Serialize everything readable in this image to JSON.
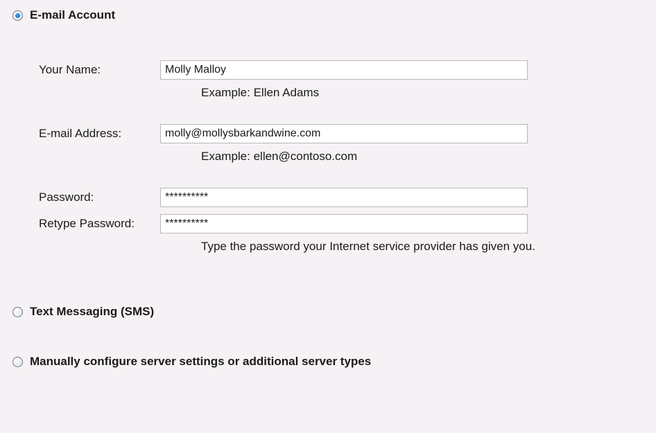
{
  "options": {
    "email": "E-mail Account",
    "sms": "Text Messaging (SMS)",
    "manual": "Manually configure server settings or additional server types"
  },
  "form": {
    "name": {
      "label": "Your Name:",
      "value": "Molly Malloy",
      "example": "Example: Ellen Adams"
    },
    "email": {
      "label": "E-mail Address:",
      "value": "molly@mollysbarkandwine.com",
      "example": "Example: ellen@contoso.com"
    },
    "password": {
      "label": "Password:",
      "value": "**********"
    },
    "retype": {
      "label": "Retype Password:",
      "value": "**********"
    },
    "password_hint": "Type the password your Internet service provider has given you."
  }
}
